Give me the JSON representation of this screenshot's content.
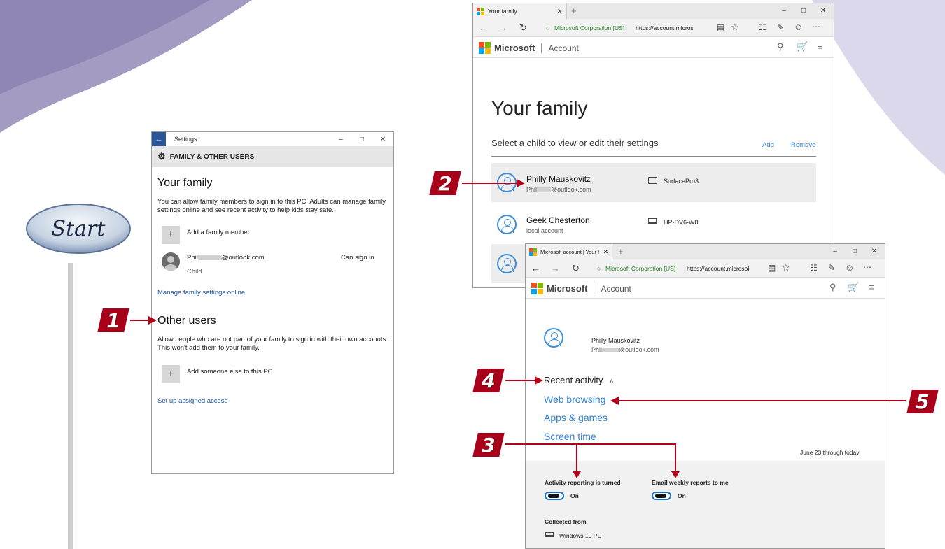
{
  "settings_window": {
    "title": "Settings",
    "back_glyph": "←",
    "header": "FAMILY & OTHER USERS",
    "family_heading": "Your family",
    "family_desc": "You can allow family members to sign in to this PC. Adults can manage family settings online and see recent activity to help kids stay safe.",
    "add_family_label": "Add a family member",
    "member": {
      "email_prefix": "Phil",
      "email_suffix": "@outlook.com",
      "role": "Child",
      "status": "Can sign in"
    },
    "manage_link": "Manage family settings online",
    "other_heading": "Other users",
    "other_desc": "Allow people who are not part of your family to sign in with their own accounts. This won't add them to your family.",
    "add_other_label": "Add someone else to this PC",
    "assigned_access_link": "Set up assigned access"
  },
  "browser_back": {
    "tab_title": "Your family",
    "security": "Microsoft Corporation [US]",
    "url": "https://account.micros",
    "brand": "Microsoft",
    "section": "Account",
    "page_title": "Your family",
    "subtitle": "Select a child to view or edit their settings",
    "add_label": "Add",
    "remove_label": "Remove",
    "children": [
      {
        "name": "Philly Mauskovitz",
        "account_prefix": "Phil",
        "account_suffix": "@outlook.com",
        "device": "SurfacePro3"
      },
      {
        "name": "Geek Chesterton",
        "account": "local account",
        "device": "HP-DV6-W8"
      }
    ]
  },
  "browser_front": {
    "tab_title": "Microsoft account | Your f",
    "security": "Microsoft Corporation [US]",
    "url": "https://account.microsol",
    "brand": "Microsoft",
    "section": "Account",
    "profile_name": "Philly Mauskovitz",
    "profile_email_prefix": "Phil",
    "profile_email_suffix": "@outlook.com",
    "recent_activity": "Recent activity",
    "web_browsing": "Web browsing",
    "apps_games": "Apps & games",
    "screen_time": "Screen time",
    "date_range": "June 23 through today",
    "activity_reporting": "Activity reporting is turned",
    "activity_state": "On",
    "email_weekly": "Email weekly reports to me",
    "email_state": "On",
    "collected_from": "Collected from",
    "device": "Windows 10 PC"
  },
  "callouts": {
    "start": "Start",
    "one": "1",
    "two": "2",
    "three": "3",
    "four": "4",
    "five": "5"
  },
  "colors": {
    "callout_red": "#b3001b",
    "link_blue": "#2f7fd3",
    "settings_accent": "#2b579a"
  }
}
